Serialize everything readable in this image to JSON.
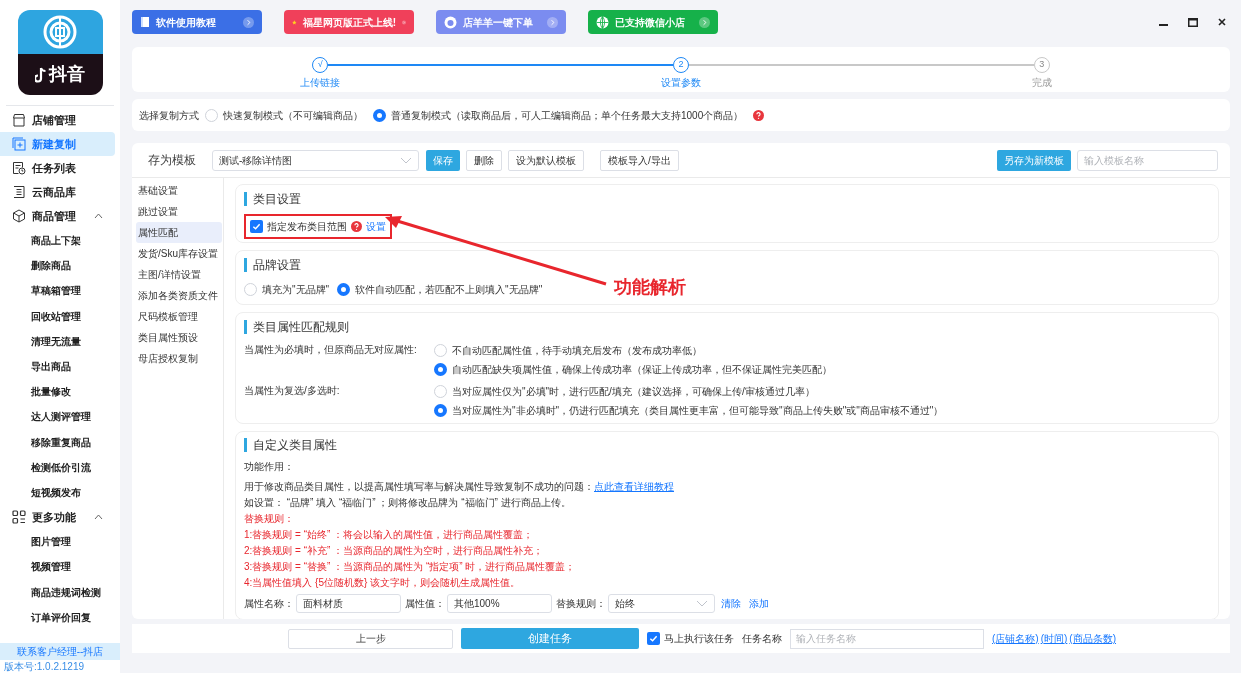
{
  "logo": {
    "text": "抖音"
  },
  "sidebar": {
    "items": [
      {
        "kind": "item",
        "label": "店铺管理",
        "selected": false
      },
      {
        "kind": "item",
        "label": "新建复制",
        "selected": true
      },
      {
        "kind": "item",
        "label": "任务列表",
        "selected": false
      },
      {
        "kind": "item",
        "label": "云商品库",
        "selected": false
      },
      {
        "kind": "group",
        "label": "商品管理",
        "expanded": true,
        "children": [
          {
            "label": "商品上下架"
          },
          {
            "label": "删除商品"
          },
          {
            "label": "草稿箱管理"
          },
          {
            "label": "回收站管理"
          },
          {
            "label": "清理无流量"
          },
          {
            "label": "导出商品"
          },
          {
            "label": "批量修改"
          },
          {
            "label": "达人测评管理"
          },
          {
            "label": "移除重复商品"
          },
          {
            "label": "检测低价引流"
          },
          {
            "label": "短视频发布"
          }
        ]
      },
      {
        "kind": "group",
        "label": "更多功能",
        "expanded": true,
        "children": [
          {
            "label": "图片管理"
          },
          {
            "label": "视频管理"
          },
          {
            "label": "商品违规词检测"
          },
          {
            "label": "订单评价回复"
          }
        ]
      }
    ],
    "contact": "联系客户经理--抖店",
    "version": "版本号:1.0.2.1219"
  },
  "banners": [
    {
      "label": "软件使用教程",
      "color": "#3b6fe6"
    },
    {
      "label": "福星网页版正式上线!",
      "color": "#f0405a"
    },
    {
      "label": "店羊羊一键下单",
      "color": "#7b8cf0"
    },
    {
      "label": "已支持微信小店",
      "color": "#16b14a"
    }
  ],
  "stepper": [
    {
      "marker": "√",
      "label": "上传链接",
      "reached": true
    },
    {
      "marker": "2",
      "label": "设置参数",
      "reached": true
    },
    {
      "marker": "3",
      "label": "完成",
      "reached": false
    }
  ],
  "copy_mode": {
    "label": "选择复制方式",
    "options": [
      {
        "label": "快速复制模式（不可编辑商品）",
        "selected": false
      },
      {
        "label": "普通复制模式（读取商品后，可人工编辑商品；单个任务最大支持1000个商品）",
        "selected": true
      }
    ]
  },
  "template_bar": {
    "label": "存为模板",
    "select_value": "测试-移除详情图",
    "buttons": [
      {
        "label": "保存",
        "primary": true
      },
      {
        "label": "删除",
        "primary": false
      },
      {
        "label": "设为默认模板",
        "primary": false
      },
      {
        "label": "模板导入/导出",
        "primary": false
      }
    ],
    "save_as": "另存为新模板",
    "name_placeholder": "输入模板名称"
  },
  "settings_tabs": [
    {
      "label": "基础设置",
      "selected": false
    },
    {
      "label": "跳过设置",
      "selected": false
    },
    {
      "label": "属性匹配",
      "selected": true
    },
    {
      "label": "发货/Sku库存设置",
      "selected": false
    },
    {
      "label": "主图/详情设置",
      "selected": false
    },
    {
      "label": "添加各类资质文件",
      "selected": false
    },
    {
      "label": "尺码模板管理",
      "selected": false
    },
    {
      "label": "类目属性预设",
      "selected": false
    },
    {
      "label": "母店授权复制",
      "selected": false
    }
  ],
  "category_settings": {
    "title": "类目设置",
    "checkbox": {
      "label": "指定发布类目范围",
      "checked": true
    },
    "link": "设置"
  },
  "brand_settings": {
    "title": "品牌设置",
    "options": [
      {
        "label": "填充为\"无品牌\"",
        "selected": false
      },
      {
        "label": "软件自动匹配，若匹配不上则填入\"无品牌\"",
        "selected": true
      }
    ]
  },
  "match_rules": {
    "title": "类目属性匹配规则",
    "groups": [
      {
        "label": "当属性为必填时，但原商品无对应属性:",
        "options": [
          {
            "label": "不自动匹配属性值，待手动填充后发布（发布成功率低）",
            "selected": false
          },
          {
            "label": "自动匹配缺失项属性值，确保上传成功率（保证上传成功率，但不保证属性完美匹配）",
            "selected": true
          }
        ]
      },
      {
        "label": "当属性为复选/多选时:",
        "options": [
          {
            "label": "当对应属性仅为\"必填\"时，进行匹配/填充（建议选择，可确保上传/审核通过几率）",
            "selected": false
          },
          {
            "label": "当对应属性为\"非必填时\"，仍进行匹配填充（类目属性更丰富，但可能导致\"商品上传失败\"或\"商品审核不通过\"）",
            "selected": true
          }
        ]
      }
    ]
  },
  "custom_attributes": {
    "title": "自定义类目属性",
    "purpose": "功能作用：",
    "description": "用于修改商品类目属性，以提高属性填写率与解决属性导致复制不成功的问题：",
    "tutorial_link": "点此查看详细教程",
    "example": "如设置： “品牌” 填入 “福临门” ；则将修改品牌为 “福临门” 进行商品上传。",
    "rules": [
      "替换规则：",
      "1:替换规则 = “始终” ：将会以输入的属性值，进行商品属性覆盖；",
      "2:替换规则 = “补充” ：当源商品的属性为空时，进行商品属性补充；",
      "3:替换规则 = “替换” ：当源商品的属性为 “指定项” 时，进行商品属性覆盖；",
      "4:当属性值填入 {5位随机数} 该文字时，则会随机生成属性值。"
    ],
    "row": {
      "name_label": "属性名称：",
      "name_value": "面料材质",
      "value_label": "属性值：",
      "value_value": "其他100%",
      "rule_label": "替换规则：",
      "rule_value": "始终",
      "clear": "清除",
      "add": "添加"
    }
  },
  "annotation": {
    "label": "功能解析"
  },
  "bottom_bar": {
    "prev": "上一步",
    "create": "创建任务",
    "run_now": {
      "label": "马上执行该任务",
      "checked": true
    },
    "task_name_label": "任务名称",
    "task_name_placeholder": "输入任务名称",
    "tokens": [
      "(店铺名称)",
      "(时间)",
      "(商品条数)"
    ]
  }
}
